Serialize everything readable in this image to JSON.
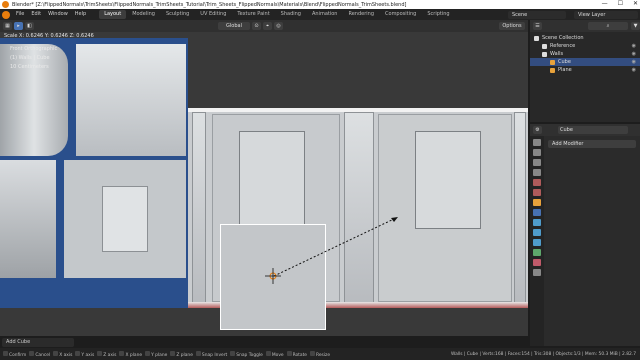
{
  "titlebar": {
    "title": "Blender* [Z:\\FlippedNormals\\TrimSheets\\FlippedNormals_TrimSheets_Tutorial\\Trim_Sheets_FlippedNormals\\Materials\\Blend\\FlippedNormals_TrimSheets.blend]",
    "min": "—",
    "max": "☐",
    "close": "✕"
  },
  "menu": {
    "items": [
      "File",
      "Edit",
      "Window",
      "Help"
    ],
    "workspaces": [
      "Layout",
      "Modeling",
      "Sculpting",
      "UV Editing",
      "Texture Paint",
      "Shading",
      "Animation",
      "Rendering",
      "Compositing",
      "Scripting"
    ],
    "scene": "Scene",
    "view_layer": "View Layer"
  },
  "viewport_header": {
    "transform": "Global",
    "options": "Options"
  },
  "viewport": {
    "scale_readout": "Scale X: 0.6246  Y: 0.6246  Z: 0.6246",
    "view_name": "Front Orthographic",
    "object_info": "(1) Walls | Cube",
    "units": "10 Centimeters"
  },
  "outliner": {
    "root": "Scene Collection",
    "items": [
      "Reference",
      "Walls",
      "Cube",
      "Plane"
    ]
  },
  "properties": {
    "object_name": "Cube",
    "add_modifier": "Add Modifier"
  },
  "redo_panel": {
    "label": "Add Cube"
  },
  "statusbar": {
    "items": [
      "Confirm",
      "Cancel",
      "X axis",
      "Y axis",
      "Z axis",
      "X plane",
      "Y plane",
      "Z plane",
      "Snap Invert",
      "Snap Toggle",
      "Move",
      "Rotate",
      "Resize"
    ],
    "stats": "Walls | Cube | Verts:168 | Faces:154 | Tris:308 | Objects:1/3 | Mem: 50.3 MiB | 2.82.7"
  },
  "colors": {
    "accent": "#4772b3",
    "blender_orange": "#e87d0d",
    "reference_blue": "#2a4f8c"
  }
}
